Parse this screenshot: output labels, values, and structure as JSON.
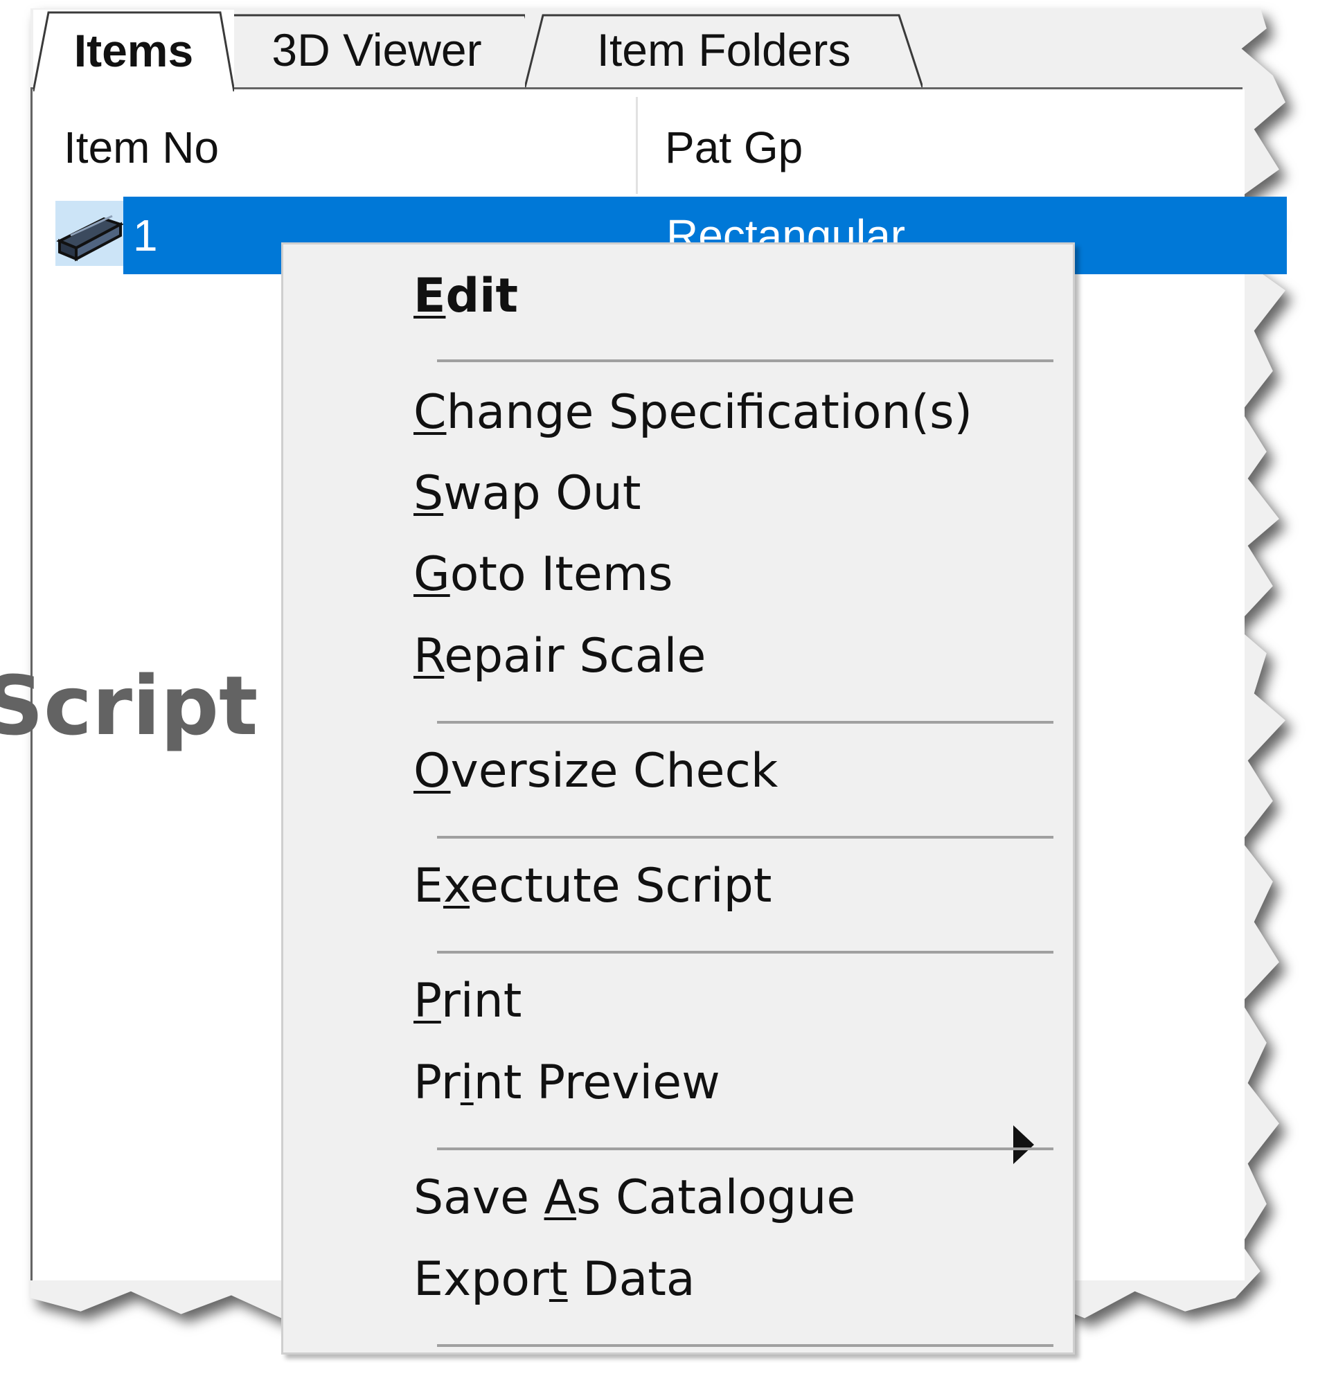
{
  "tabs": [
    {
      "label": "Items",
      "active": true
    },
    {
      "label": "3D Viewer",
      "active": false
    },
    {
      "label": "Item Folders",
      "active": false
    }
  ],
  "columns": [
    "Item No",
    "Pat Gp"
  ],
  "rows": [
    {
      "item_no": "1",
      "pat_gp": "Rectangular",
      "icon": "rectangular-block-icon",
      "selected": true
    }
  ],
  "background_label": "Script",
  "context_menu": {
    "items": [
      {
        "label": "Edit",
        "mnemonic": "E",
        "bold": true
      },
      {
        "label": "Change Specification(s)",
        "mnemonic": "C"
      },
      {
        "label": "Swap Out",
        "mnemonic": "S"
      },
      {
        "label": "Goto Items",
        "mnemonic": "G"
      },
      {
        "label": "Repair Scale",
        "mnemonic": "R"
      },
      {
        "label": "Oversize Check",
        "mnemonic": "O"
      },
      {
        "label": "Exectute Script",
        "mnemonic": "x",
        "submenu": true
      },
      {
        "label": "Print",
        "mnemonic": "P"
      },
      {
        "label": "Print Preview",
        "mnemonic": "i"
      },
      {
        "label": "Save As Catalogue",
        "mnemonic": "A"
      },
      {
        "label": "Export Data",
        "mnemonic": "t"
      }
    ]
  },
  "colors": {
    "selection": "#0078d7",
    "selection_icon_bg": "#cce4f7",
    "menu_bg": "#f0f0f0",
    "separator": "#a0a0a0"
  }
}
